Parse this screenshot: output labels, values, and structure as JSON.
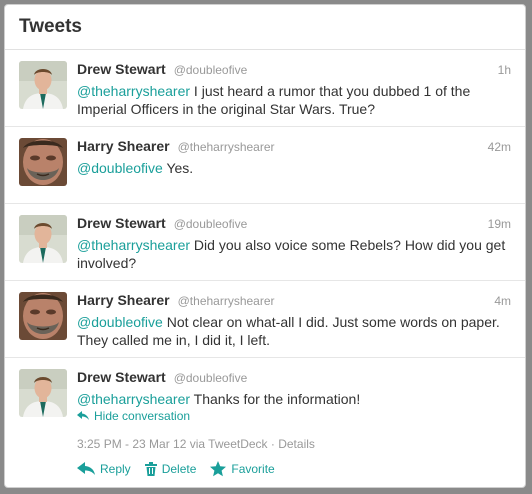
{
  "panel": {
    "title": "Tweets"
  },
  "tweets": [
    {
      "name": "Drew Stewart",
      "handle": "@doubleofive",
      "time": "1h",
      "mention": "@theharryshearer",
      "text": " I just heard a rumor that you dubbed 1 of the Imperial Officers in the original Star Wars. True?",
      "avatar": "drew-avatar"
    },
    {
      "name": "Harry Shearer",
      "handle": "@theharryshearer",
      "time": "42m",
      "mention": "@doubleofive",
      "text": " Yes.",
      "avatar": "harry-avatar"
    },
    {
      "name": "Drew Stewart",
      "handle": "@doubleofive",
      "time": "19m",
      "mention": "@theharryshearer",
      "text": " Did you also voice some Rebels? How did you get involved?",
      "avatar": "drew-avatar"
    },
    {
      "name": "Harry Shearer",
      "handle": "@theharryshearer",
      "time": "4m",
      "mention": "@doubleofive",
      "text": " Not clear on what-all I did. Just some words on paper. They called me in, I did it, I left.",
      "avatar": "harry-avatar"
    },
    {
      "name": "Drew Stewart",
      "handle": "@doubleofive",
      "time": "",
      "mention": "@theharryshearer",
      "text": " Thanks for the information!",
      "avatar": "drew-avatar"
    }
  ],
  "expanded": {
    "hide_conversation": "Hide conversation",
    "timestamp": "3:25 PM - 23 Mar 12",
    "via": " via TweetDeck",
    "separator": " · ",
    "details": "Details",
    "reply": "Reply",
    "delete": "Delete",
    "favorite": "Favorite"
  },
  "colors": {
    "accent": "#1a9f9a",
    "muted": "#999999",
    "text": "#333333"
  }
}
